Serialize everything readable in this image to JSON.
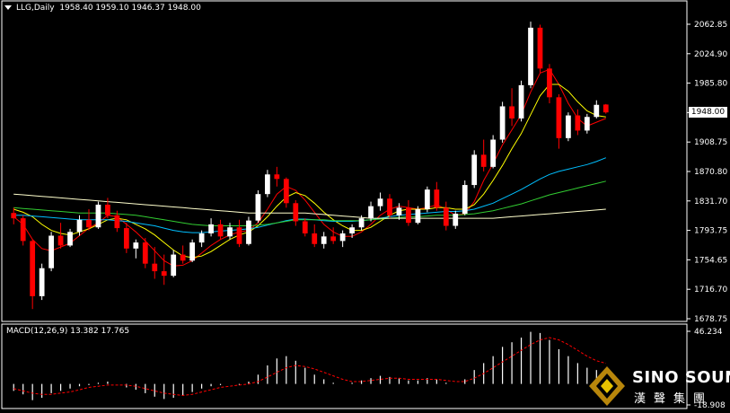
{
  "symbol_header": "LLG,Daily  1958.40 1959.10 1946.37 1948.00",
  "current_price_label": "1948.00",
  "macd_header": "MACD(12,26,9) 13.382 17.765",
  "price_axis_labels": [
    "2062.85",
    "2024.90",
    "1985.80",
    "1948.00",
    "1908.75",
    "1870.80",
    "1831.70",
    "1793.75",
    "1754.65",
    "1716.70",
    "1678.75"
  ],
  "macd_axis_labels": [
    "46.234",
    "-18.908"
  ],
  "logo": {
    "main": "SINO SOUND",
    "sub": "漢聲集團"
  },
  "colors": {
    "background": "#000000",
    "up_candle": "#ffffff",
    "down_candle": "#ff0000",
    "axis": "#ffffff",
    "ma_fast": "#ff0000",
    "ma_mid": "#ffff00",
    "ma_long1": "#00bfff",
    "ma_long2": "#32cd32",
    "ma_long3": "#ffffcc",
    "macd_signal": "#ff0000",
    "macd_hist": "#ffffff"
  },
  "chart_data": {
    "type": "candlestick",
    "price_range": [
      1678.75,
      2080
    ],
    "ohlc": [
      [
        1815,
        1822,
        1800,
        1808
      ],
      [
        1808,
        1812,
        1772,
        1778
      ],
      [
        1778,
        1780,
        1688,
        1705
      ],
      [
        1705,
        1748,
        1700,
        1742
      ],
      [
        1742,
        1790,
        1738,
        1785
      ],
      [
        1785,
        1802,
        1768,
        1772
      ],
      [
        1772,
        1794,
        1770,
        1790
      ],
      [
        1790,
        1812,
        1785,
        1806
      ],
      [
        1806,
        1820,
        1792,
        1796
      ],
      [
        1796,
        1830,
        1794,
        1826
      ],
      [
        1826,
        1835,
        1808,
        1812
      ],
      [
        1812,
        1818,
        1790,
        1795
      ],
      [
        1795,
        1802,
        1762,
        1768
      ],
      [
        1768,
        1780,
        1755,
        1776
      ],
      [
        1776,
        1782,
        1742,
        1748
      ],
      [
        1748,
        1770,
        1728,
        1738
      ],
      [
        1738,
        1760,
        1720,
        1732
      ],
      [
        1732,
        1766,
        1730,
        1760
      ],
      [
        1760,
        1772,
        1748,
        1752
      ],
      [
        1752,
        1780,
        1750,
        1776
      ],
      [
        1776,
        1792,
        1770,
        1788
      ],
      [
        1788,
        1808,
        1784,
        1800
      ],
      [
        1800,
        1806,
        1780,
        1784
      ],
      [
        1784,
        1802,
        1780,
        1796
      ],
      [
        1796,
        1806,
        1770,
        1774
      ],
      [
        1774,
        1810,
        1772,
        1805
      ],
      [
        1805,
        1845,
        1802,
        1840
      ],
      [
        1840,
        1872,
        1836,
        1866
      ],
      [
        1866,
        1876,
        1850,
        1860
      ],
      [
        1860,
        1862,
        1822,
        1828
      ],
      [
        1828,
        1832,
        1798,
        1804
      ],
      [
        1804,
        1808,
        1784,
        1788
      ],
      [
        1788,
        1800,
        1770,
        1774
      ],
      [
        1774,
        1790,
        1768,
        1784
      ],
      [
        1784,
        1796,
        1774,
        1778
      ],
      [
        1778,
        1792,
        1770,
        1788
      ],
      [
        1788,
        1800,
        1782,
        1796
      ],
      [
        1796,
        1812,
        1792,
        1808
      ],
      [
        1808,
        1830,
        1804,
        1824
      ],
      [
        1824,
        1842,
        1818,
        1834
      ],
      [
        1834,
        1840,
        1808,
        1812
      ],
      [
        1812,
        1828,
        1806,
        1822
      ],
      [
        1822,
        1832,
        1798,
        1802
      ],
      [
        1802,
        1824,
        1800,
        1820
      ],
      [
        1820,
        1850,
        1816,
        1846
      ],
      [
        1846,
        1856,
        1818,
        1822
      ],
      [
        1822,
        1830,
        1792,
        1798
      ],
      [
        1798,
        1818,
        1794,
        1814
      ],
      [
        1814,
        1858,
        1812,
        1852
      ],
      [
        1852,
        1898,
        1848,
        1892
      ],
      [
        1892,
        1912,
        1870,
        1876
      ],
      [
        1876,
        1918,
        1874,
        1912
      ],
      [
        1912,
        1962,
        1908,
        1956
      ],
      [
        1956,
        1980,
        1930,
        1940
      ],
      [
        1940,
        1990,
        1936,
        1984
      ],
      [
        1984,
        2068,
        1980,
        2060
      ],
      [
        2060,
        2064,
        2000,
        2006
      ],
      [
        2006,
        2012,
        1960,
        1968
      ],
      [
        1968,
        1972,
        1900,
        1914
      ],
      [
        1914,
        1948,
        1910,
        1944
      ],
      [
        1944,
        1952,
        1918,
        1924
      ],
      [
        1924,
        1946,
        1920,
        1942
      ],
      [
        1942,
        1964,
        1940,
        1958
      ],
      [
        1958.4,
        1959.1,
        1946.37,
        1948.0
      ]
    ],
    "macd_range": [
      -18.908,
      46.234
    ],
    "macd_hist": [
      -6,
      -9,
      -14,
      -12,
      -8,
      -6,
      -4,
      -2,
      -1,
      1,
      2,
      0,
      -3,
      -5,
      -8,
      -11,
      -13,
      -12,
      -10,
      -7,
      -4,
      -2,
      -1,
      0,
      -1,
      2,
      8,
      16,
      22,
      24,
      20,
      14,
      8,
      4,
      1,
      0,
      1,
      3,
      5,
      7,
      6,
      5,
      3,
      3,
      5,
      4,
      1,
      0,
      4,
      12,
      18,
      24,
      32,
      36,
      40,
      45,
      44,
      38,
      30,
      24,
      18,
      14,
      12,
      13.4
    ],
    "macd_signal": [
      -4,
      -6,
      -8,
      -9,
      -9,
      -8,
      -7,
      -5,
      -3,
      -2,
      -1,
      -1,
      -1,
      -2,
      -4,
      -6,
      -8,
      -9,
      -10,
      -9,
      -7,
      -5,
      -3,
      -2,
      -1,
      0,
      2,
      6,
      10,
      14,
      16,
      15,
      13,
      10,
      7,
      4,
      2,
      2,
      3,
      4,
      5,
      5,
      4,
      4,
      4,
      4,
      3,
      2,
      2,
      5,
      9,
      14,
      19,
      24,
      29,
      34,
      38,
      40,
      38,
      34,
      29,
      24,
      20,
      17.8
    ],
    "moving_averages": [
      {
        "values": [
          1810,
          1800,
          1780,
          1768,
          1765,
          1770,
          1775,
          1785,
          1795,
          1802,
          1812,
          1810,
          1800,
          1790,
          1778,
          1765,
          1752,
          1745,
          1746,
          1752,
          1762,
          1772,
          1780,
          1786,
          1790,
          1792,
          1802,
          1820,
          1840,
          1850,
          1845,
          1832,
          1816,
          1800,
          1790,
          1784,
          1784,
          1790,
          1800,
          1812,
          1820,
          1824,
          1822,
          1820,
          1822,
          1826,
          1820,
          1812,
          1814,
          1830,
          1858,
          1880,
          1905,
          1925,
          1945,
          1975,
          2000,
          2005,
          1985,
          1960,
          1940,
          1930,
          1935,
          1940
        ]
      },
      {
        "values": [
          1820,
          1816,
          1810,
          1800,
          1792,
          1788,
          1786,
          1790,
          1794,
          1800,
          1806,
          1808,
          1806,
          1800,
          1794,
          1786,
          1776,
          1766,
          1758,
          1756,
          1758,
          1764,
          1772,
          1780,
          1786,
          1790,
          1798,
          1810,
          1824,
          1836,
          1842,
          1838,
          1828,
          1816,
          1806,
          1798,
          1792,
          1792,
          1796,
          1804,
          1812,
          1818,
          1820,
          1820,
          1820,
          1822,
          1822,
          1820,
          1820,
          1826,
          1840,
          1858,
          1878,
          1900,
          1920,
          1945,
          1970,
          1985,
          1985,
          1976,
          1962,
          1950,
          1944,
          1942
        ]
      },
      {
        "values": [
          1812,
          1812,
          1811,
          1810,
          1809,
          1808,
          1807,
          1806,
          1806,
          1806,
          1806,
          1805,
          1804,
          1802,
          1800,
          1798,
          1795,
          1792,
          1790,
          1789,
          1789,
          1790,
          1791,
          1792,
          1793,
          1794,
          1796,
          1799,
          1802,
          1805,
          1807,
          1807,
          1806,
          1805,
          1804,
          1804,
          1804,
          1805,
          1806,
          1808,
          1810,
          1812,
          1813,
          1814,
          1815,
          1816,
          1817,
          1817,
          1818,
          1820,
          1824,
          1828,
          1834,
          1840,
          1846,
          1853,
          1860,
          1866,
          1870,
          1873,
          1876,
          1879,
          1883,
          1888
        ]
      },
      {
        "values": [
          1822,
          1821,
          1820,
          1819,
          1818,
          1817,
          1816,
          1815,
          1815,
          1815,
          1815,
          1814,
          1813,
          1812,
          1810,
          1808,
          1806,
          1804,
          1802,
          1800,
          1799,
          1798,
          1798,
          1798,
          1798,
          1798,
          1799,
          1800,
          1802,
          1804,
          1806,
          1806,
          1806,
          1806,
          1805,
          1805,
          1805,
          1805,
          1806,
          1807,
          1808,
          1809,
          1810,
          1810,
          1811,
          1812,
          1812,
          1812,
          1813,
          1814,
          1816,
          1818,
          1821,
          1824,
          1827,
          1831,
          1835,
          1839,
          1842,
          1845,
          1848,
          1851,
          1854,
          1857
        ]
      },
      {
        "values": [
          1840,
          1839,
          1838,
          1837,
          1836,
          1835,
          1834,
          1833,
          1832,
          1831,
          1830,
          1829,
          1828,
          1827,
          1826,
          1825,
          1824,
          1823,
          1822,
          1821,
          1820,
          1819,
          1818,
          1817,
          1816,
          1815,
          1815,
          1815,
          1815,
          1815,
          1815,
          1815,
          1814,
          1813,
          1812,
          1811,
          1810,
          1809,
          1808,
          1808,
          1808,
          1808,
          1808,
          1808,
          1808,
          1808,
          1808,
          1808,
          1808,
          1808,
          1808,
          1808,
          1809,
          1810,
          1811,
          1812,
          1813,
          1814,
          1815,
          1816,
          1817,
          1818,
          1819,
          1820
        ]
      }
    ]
  }
}
